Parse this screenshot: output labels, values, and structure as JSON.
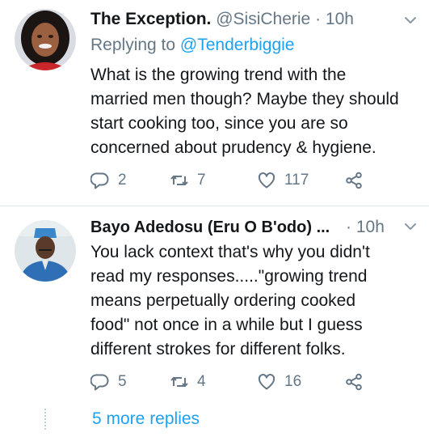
{
  "tweets": [
    {
      "name": "The Exception.",
      "handle": "@SisiCherie",
      "separator": "·",
      "time": "10h",
      "replying_prefix": "Replying to",
      "replying_to": "@Tenderbiggie",
      "text_lines": [
        "What is the growing trend with the",
        "married men though? Maybe they should",
        "start cooking too, since you are so",
        "concerned about prudency & hygiene."
      ],
      "reply_count": "2",
      "retweet_count": "7",
      "like_count": "117"
    },
    {
      "name": "Bayo Adedosu (Eru O B'odo) ...",
      "separator": "·",
      "time": "10h",
      "text_lines": [
        "You lack context that's why you didn't",
        "read my responses.....\"growing trend",
        "means perpetually ordering cooked",
        "food\" not once in a while but I guess",
        "different strokes for different folks."
      ],
      "reply_count": "5",
      "retweet_count": "4",
      "like_count": "16"
    }
  ],
  "more_replies": "5 more replies",
  "icons": {
    "reply": "reply-icon",
    "retweet": "retweet-icon",
    "like": "heart-icon",
    "share": "share-icon",
    "menu": "chevron-down-icon"
  },
  "colors": {
    "text": "#14171a",
    "secondary": "#657786",
    "accent": "#1da1f2",
    "divider": "#e1e8ed"
  }
}
